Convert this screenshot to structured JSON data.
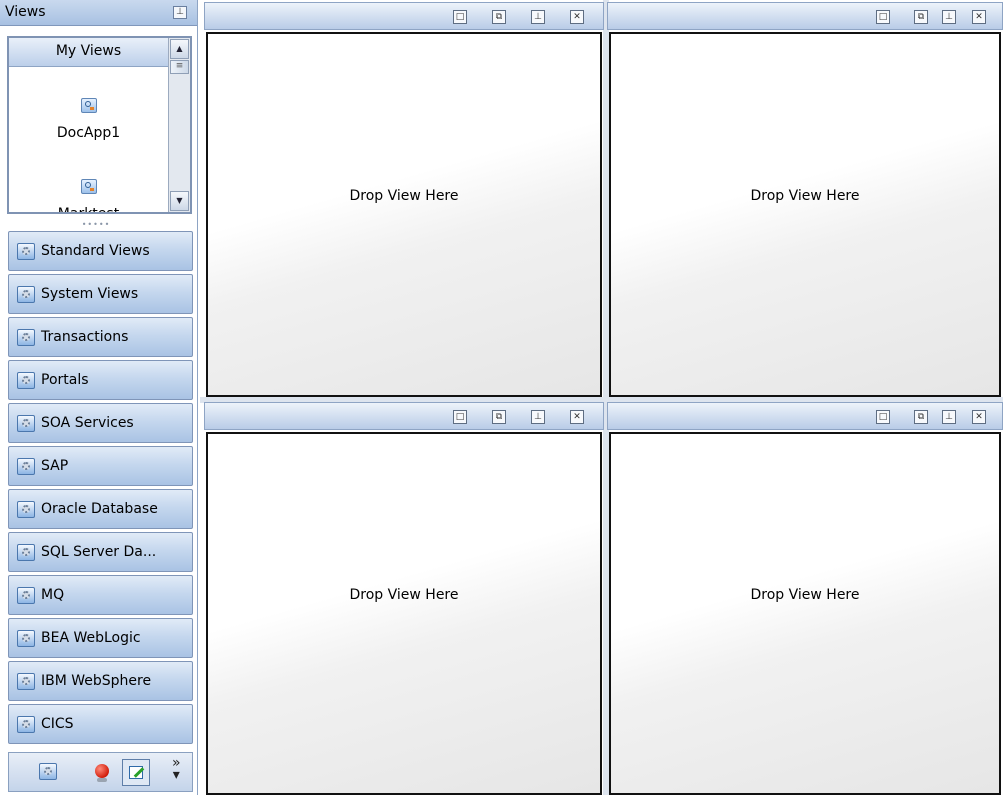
{
  "views_pane": {
    "title": "Views",
    "pin_icon": "pin-icon",
    "my_views": {
      "header": "My Views",
      "items": [
        {
          "label": "DocApp1",
          "icon": "view-icon"
        },
        {
          "label": "Marktest",
          "icon": "view-icon"
        }
      ]
    },
    "categories": [
      {
        "label": "Standard Views"
      },
      {
        "label": "System Views"
      },
      {
        "label": "Transactions"
      },
      {
        "label": "Portals"
      },
      {
        "label": "SOA Services"
      },
      {
        "label": "SAP"
      },
      {
        "label": "Oracle Database"
      },
      {
        "label": "SQL Server Da..."
      },
      {
        "label": "MQ"
      },
      {
        "label": "BEA WebLogic"
      },
      {
        "label": "IBM WebSphere"
      },
      {
        "label": "CICS"
      }
    ],
    "toolbar": {
      "icons": [
        "gear-icon",
        "alert-icon",
        "edit-icon"
      ],
      "more_glyph": "»"
    }
  },
  "panels": [
    {
      "placeholder": "Drop View Here"
    },
    {
      "placeholder": "Drop View Here"
    },
    {
      "placeholder": "Drop View Here"
    },
    {
      "placeholder": "Drop View Here"
    }
  ],
  "panel_buttons": [
    "maximize-icon",
    "restore-icon",
    "pin-icon",
    "close-icon"
  ],
  "colors": {
    "header_blue": "#a8c1e2",
    "button_blue": "#c5d7ee",
    "panel_border": "#111111"
  }
}
